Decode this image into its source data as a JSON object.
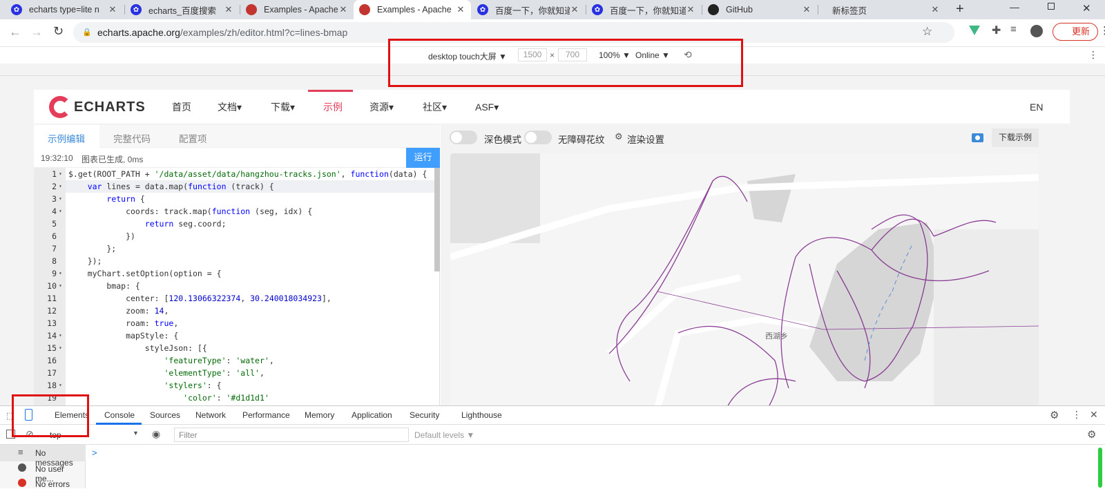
{
  "browser": {
    "tabs": [
      {
        "title": "echarts type=lite n",
        "favicon": "baidu-paw-icon"
      },
      {
        "title": "echarts_百度搜索",
        "favicon": "baidu-paw-icon"
      },
      {
        "title": "Examples - Apache",
        "favicon": "echarts-logo-icon"
      },
      {
        "title": "Examples - Apache",
        "favicon": "echarts-logo-icon"
      },
      {
        "title": "百度一下，你就知道",
        "favicon": "baidu-paw-icon"
      },
      {
        "title": "百度一下，你就知道",
        "favicon": "baidu-paw-icon"
      },
      {
        "title": "GitHub",
        "favicon": "github-icon"
      },
      {
        "title": "新标签页",
        "favicon": "none"
      }
    ],
    "url_host": "echarts.apache.org",
    "url_path": "/examples/zh/editor.html?c=lines-bmap",
    "update_label": "更新"
  },
  "device_toolbar": {
    "device": "desktop touch大屏 ▼",
    "width": "1500",
    "height": "700",
    "times": "×",
    "zoom": "100% ▼",
    "throttle": "Online ▼"
  },
  "site": {
    "logo": "ECHARTS",
    "nav": [
      "首页",
      "文档▾",
      "下载▾",
      "示例",
      "资源▾",
      "社区▾",
      "ASF▾"
    ],
    "lang": "EN"
  },
  "editor": {
    "tabs": [
      "示例编辑",
      "完整代码",
      "配置项"
    ],
    "status_time": "19:32:10",
    "status_msg": "图表已生成, 0ms",
    "run_label": "运行",
    "lines": [
      {
        "n": "1",
        "fold": true,
        "code": "$.get(ROOT_PATH + '/data/asset/data/hangzhou-tracks.json', function(data) {"
      },
      {
        "n": "2",
        "fold": true,
        "code": "    var lines = data.map(function (track) {"
      },
      {
        "n": "3",
        "fold": true,
        "code": "        return {"
      },
      {
        "n": "4",
        "fold": true,
        "code": "            coords: track.map(function (seg, idx) {"
      },
      {
        "n": "5",
        "fold": false,
        "code": "                return seg.coord;"
      },
      {
        "n": "6",
        "fold": false,
        "code": "            })"
      },
      {
        "n": "7",
        "fold": false,
        "code": "        };"
      },
      {
        "n": "8",
        "fold": false,
        "code": "    });"
      },
      {
        "n": "9",
        "fold": true,
        "code": "    myChart.setOption(option = {"
      },
      {
        "n": "10",
        "fold": true,
        "code": "        bmap: {"
      },
      {
        "n": "11",
        "fold": false,
        "code": "            center: [120.13066322374, 30.240018034923],"
      },
      {
        "n": "12",
        "fold": false,
        "code": "            zoom: 14,"
      },
      {
        "n": "13",
        "fold": false,
        "code": "            roam: true,"
      },
      {
        "n": "14",
        "fold": true,
        "code": "            mapStyle: {"
      },
      {
        "n": "15",
        "fold": true,
        "code": "                styleJson: [{"
      },
      {
        "n": "16",
        "fold": false,
        "code": "                    'featureType': 'water',"
      },
      {
        "n": "17",
        "fold": false,
        "code": "                    'elementType': 'all',"
      },
      {
        "n": "18",
        "fold": true,
        "code": "                    'stylers': {"
      },
      {
        "n": "19",
        "fold": false,
        "code": "                        'color': '#d1d1d1'"
      }
    ]
  },
  "preview": {
    "dark_mode": "深色模式",
    "aria": "无障碍花纹",
    "render_settings": "渲染设置",
    "download": "下载示例",
    "map_label": "西湖乡"
  },
  "devtools": {
    "tabs": [
      "Elements",
      "Console",
      "Sources",
      "Network",
      "Performance",
      "Memory",
      "Application",
      "Security",
      "Lighthouse"
    ],
    "context": "top",
    "filter_placeholder": "Filter",
    "levels": "Default levels ▼",
    "sidebar": [
      "No messages",
      "No user me...",
      "No errors"
    ],
    "prompt": ">"
  },
  "colors": {
    "accent": "#c23531",
    "blue": "#1a73e8",
    "track": "#8b1a8b"
  }
}
